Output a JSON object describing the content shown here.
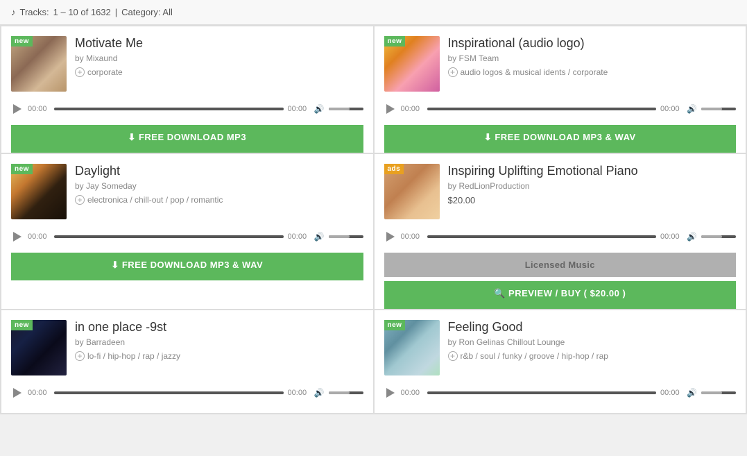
{
  "topbar": {
    "icon": "♪",
    "tracks_label": "Tracks:",
    "tracks_range": "1 – 10 of 1632",
    "separator": "|",
    "category_label": "Category: All"
  },
  "tracks": [
    {
      "id": "motivate-me",
      "badge": "new",
      "badge_type": "new",
      "title": "Motivate Me",
      "author": "by Mixaund",
      "tags": "corporate",
      "thumb_class": "thumb-motivate",
      "price": null,
      "download_label": "FREE DOWNLOAD  MP3",
      "download_type": "free",
      "time_start": "00:00",
      "time_end": "00:00",
      "licensed_label": null,
      "preview_label": null
    },
    {
      "id": "inspirational-audio",
      "badge": "new",
      "badge_type": "new",
      "title": "Inspirational (audio logo)",
      "author": "by FSM Team",
      "tags": "audio logos & musical idents / corporate",
      "thumb_class": "thumb-inspirational",
      "price": null,
      "download_label": "FREE DOWNLOAD  MP3 & WAV",
      "download_type": "free",
      "time_start": "00:00",
      "time_end": "00:00",
      "licensed_label": null,
      "preview_label": null
    },
    {
      "id": "daylight",
      "badge": "new",
      "badge_type": "new",
      "title": "Daylight",
      "author": "by Jay Someday",
      "tags": "electronica / chill-out / pop / romantic",
      "thumb_class": "thumb-daylight",
      "price": null,
      "download_label": "FREE DOWNLOAD  MP3 & WAV",
      "download_type": "free",
      "time_start": "00:00",
      "time_end": "00:00",
      "licensed_label": null,
      "preview_label": null
    },
    {
      "id": "inspiring-uplifting",
      "badge": "ads",
      "badge_type": "ads",
      "title": "Inspiring Uplifting Emotional Piano",
      "author": "by RedLionProduction",
      "tags": null,
      "thumb_class": "thumb-uplifting",
      "price": "$20.00",
      "download_label": null,
      "download_type": "paid",
      "time_start": "00:00",
      "time_end": "00:00",
      "licensed_label": "Licensed Music",
      "preview_label": "PREVIEW / BUY ( $20.00 )"
    },
    {
      "id": "in-one-place",
      "badge": "new",
      "badge_type": "new",
      "title": "in one place -9st",
      "author": "by Barradeen",
      "tags": "lo-fi / hip-hop / rap / jazzy",
      "thumb_class": "thumb-oneplace",
      "price": null,
      "download_label": null,
      "download_type": "none",
      "time_start": "00:00",
      "time_end": "00:00",
      "licensed_label": null,
      "preview_label": null
    },
    {
      "id": "feeling-good",
      "badge": "new",
      "badge_type": "new",
      "title": "Feeling Good",
      "author": "by Ron Gelinas Chillout Lounge",
      "tags": "r&b / soul / funky / groove / hip-hop / rap",
      "thumb_class": "thumb-feelinggood",
      "price": null,
      "download_label": null,
      "download_type": "none",
      "time_start": "00:00",
      "time_end": "00:00",
      "licensed_label": null,
      "preview_label": null
    }
  ]
}
